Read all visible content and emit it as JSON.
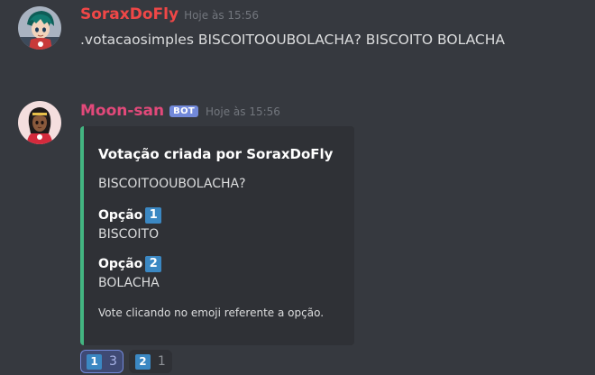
{
  "messages": [
    {
      "author": "SoraxDoFly",
      "author_color": "#f04747",
      "timestamp": "Hoje às 15:56",
      "content": ".votacaosimples BISCOITOOUBOLACHA? BISCOITO BOLACHA"
    },
    {
      "author": "Moon-san",
      "author_color": "#e2497a",
      "bot_tag": "BOT",
      "timestamp": "Hoje às 15:56",
      "embed": {
        "accent_color": "#43b581",
        "title": "Votação criada por SoraxDoFly",
        "description": "BISCOITOOUBOLACHA?",
        "fields": [
          {
            "name": "Opção",
            "keycap": "1",
            "value": "BISCOITO"
          },
          {
            "name": "Opção",
            "keycap": "2",
            "value": "BOLACHA"
          }
        ],
        "footer": "Vote clicando no emoji referente a opção."
      },
      "reactions": [
        {
          "emoji": "1",
          "count": "3",
          "reacted": true
        },
        {
          "emoji": "2",
          "count": "1",
          "reacted": false
        }
      ]
    }
  ],
  "icons": {
    "avatar_1": "anime-character-avatar",
    "avatar_2": "moon-san-bot-avatar",
    "keycap": "keycap-digit-emoji"
  }
}
